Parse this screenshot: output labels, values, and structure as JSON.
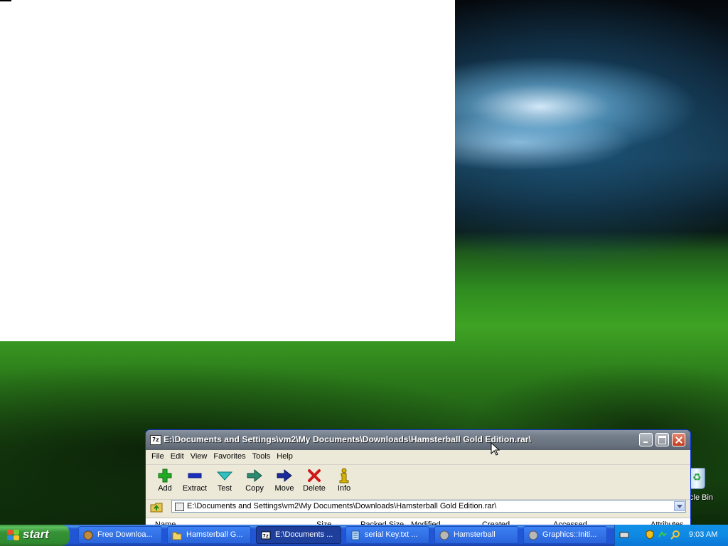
{
  "desktop": {
    "recycle_bin_label": "cle Bin"
  },
  "window": {
    "title": "E:\\Documents and Settings\\vm2\\My Documents\\Downloads\\Hamsterball Gold Edition.rar\\",
    "app_icon_text": "7z",
    "menu": [
      "File",
      "Edit",
      "View",
      "Favorites",
      "Tools",
      "Help"
    ],
    "toolbar": [
      {
        "label": "Add",
        "icon": "add-icon",
        "color": "#22aa22"
      },
      {
        "label": "Extract",
        "icon": "extract-icon",
        "color": "#1a2fbf"
      },
      {
        "label": "Test",
        "icon": "test-icon",
        "color": "#2fc0c0"
      },
      {
        "label": "Copy",
        "icon": "copy-icon",
        "color": "#2a8a72"
      },
      {
        "label": "Move",
        "icon": "move-icon",
        "color": "#1c2a9a"
      },
      {
        "label": "Delete",
        "icon": "delete-icon",
        "color": "#d01818"
      },
      {
        "label": "Info",
        "icon": "info-icon",
        "color": "#d8b400"
      }
    ],
    "address_path": "E:\\Documents and Settings\\vm2\\My Documents\\Downloads\\Hamsterball Gold Edition.rar\\",
    "columns": [
      "Name",
      "Size",
      "Packed Size",
      "Modified",
      "Created",
      "Accessed",
      "Attributes"
    ]
  },
  "taskbar": {
    "start_label": "start",
    "tasks": [
      {
        "label": "Free Downloa...",
        "icon": "browser-icon",
        "active": false
      },
      {
        "label": "Hamsterball G...",
        "icon": "folder-icon",
        "active": false
      },
      {
        "label": "E:\\Documents ...",
        "icon": "7zip-icon",
        "active": true
      },
      {
        "label": "serial Key.txt ...",
        "icon": "notepad-icon",
        "active": false
      },
      {
        "label": "Hamsterball",
        "icon": "hamsterball-icon",
        "active": false
      },
      {
        "label": "Graphics::Initi...",
        "icon": "hamsterball-icon",
        "active": false
      }
    ],
    "clock": "9:03 AM"
  }
}
